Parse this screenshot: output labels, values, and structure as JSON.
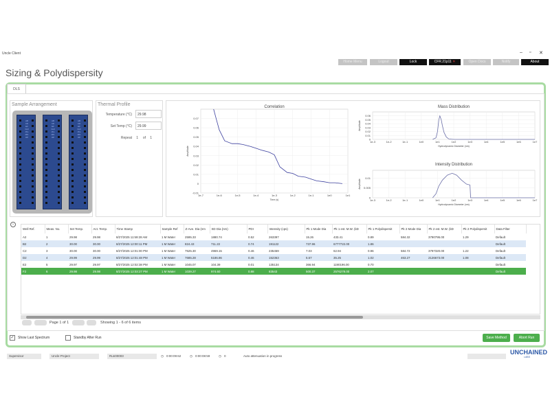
{
  "window": {
    "app_title": "Uncle Client",
    "minimize": "–",
    "maximize": "▫",
    "close": "✕"
  },
  "nav": {
    "home_menu": "Home Menu",
    "logout": "Logout",
    "lock": "Lock",
    "instrument": "CFR.21p11",
    "instrument_mark": "✕",
    "open_docs": "Open Docs",
    "notify": "Notify",
    "about": "About"
  },
  "page_title": "Sizing & Polydispersity",
  "tabs": [
    {
      "label": "DLS"
    }
  ],
  "sample_arrangement": {
    "title": "Sample Arrangement",
    "strip_letters": "ABCDEFGHIJKLMNOP"
  },
  "thermal_profile": {
    "title": "Thermal Profile",
    "temperature_label": "Temperature (°C)",
    "temperature_value": "29.98",
    "set_temp_label": "Set Temp (°C)",
    "set_temp_value": "29.99",
    "repeat_label": "Repeat",
    "repeat_current": "1",
    "repeat_of": "of",
    "repeat_total": "1"
  },
  "chart_data": [
    {
      "type": "line",
      "title": "Correlation",
      "xlabel": "Time (s)",
      "ylabel": "Amplitude",
      "x_scale": "log",
      "xlim": [
        1e-07,
        10
      ],
      "ylim": [
        -0.01,
        0.08
      ],
      "x_ticks": [
        "1e-7",
        "1e-6",
        "1e-5",
        "1e-4",
        "1e-3",
        "1e-2",
        "1e-1",
        "1e0",
        "1e1"
      ],
      "y_ticks": [
        "-0.01",
        "0",
        "0.01",
        "0.02",
        "0.03",
        "0.04",
        "0.05",
        "0.06",
        "0.07"
      ],
      "color": "#3b3f9e",
      "x": [
        5e-07,
        1e-06,
        2e-06,
        5e-06,
        1e-05,
        2e-05,
        5e-05,
        0.0001,
        0.0002,
        0.0005,
        0.001,
        0.002,
        0.005,
        0.01,
        0.02,
        0.05,
        0.1,
        0.2,
        0.5,
        1,
        2,
        5
      ],
      "y": [
        0.08,
        0.058,
        0.046,
        0.043,
        0.043,
        0.042,
        0.04,
        0.038,
        0.036,
        0.034,
        0.031,
        0.018,
        0.012,
        0.011,
        0.008,
        0.007,
        0.005,
        0.003,
        0.002,
        0.001,
        0.001,
        0.0
      ]
    },
    {
      "type": "line",
      "title": "Mass Distribution",
      "xlabel": "Hydrodynamic Diameter (nm)",
      "ylabel": "Amplitude",
      "x_scale": "log",
      "xlim": [
        0.001,
        10000000.0
      ],
      "ylim": [
        0,
        0.07
      ],
      "x_ticks": [
        "1e-3",
        "1e-2",
        "1e-1",
        "1e0",
        "1e1",
        "1e2",
        "1e3",
        "1e4",
        "1e5",
        "1e6",
        "1e7"
      ],
      "y_ticks": [
        "0",
        "0.01",
        "0.02",
        "0.03",
        "0.04",
        "0.05",
        "0.06"
      ],
      "color": "#6b6fa8",
      "x": [
        5,
        8,
        10,
        12,
        14,
        17,
        20,
        25,
        35,
        50,
        100,
        1000,
        10000000.0
      ],
      "y": [
        0,
        0.004,
        0.02,
        0.05,
        0.06,
        0.05,
        0.035,
        0.018,
        0.006,
        0.001,
        0,
        0,
        0
      ]
    },
    {
      "type": "line",
      "title": "Intensity Distribution",
      "xlabel": "Hydrodynamic Diameter (nm)",
      "ylabel": "Amplitude",
      "x_scale": "log",
      "xlim": [
        0.001,
        10000000.0
      ],
      "ylim": [
        0,
        0.014
      ],
      "x_ticks": [
        "1e-3",
        "1e-2",
        "1e-1",
        "1e0",
        "1e1",
        "1e2",
        "1e3",
        "1e4",
        "1e5",
        "1e6",
        "1e7"
      ],
      "y_ticks": [
        "0",
        "0.005",
        "0.01"
      ],
      "color": "#6b6fa8",
      "x": [
        5,
        8,
        12,
        20,
        40,
        80,
        150,
        300,
        600,
        1000,
        1100,
        10000000.0
      ],
      "y": [
        0,
        0.002,
        0.006,
        0.009,
        0.0115,
        0.0125,
        0.0115,
        0.009,
        0.007,
        0.0065,
        0,
        0
      ]
    }
  ],
  "table": {
    "columns": [
      "Well Ref.",
      "Meas. No.",
      "Set Temp.",
      "Act. Temp.",
      "Time Stamp",
      "Sample Ref",
      "Z-Ave. Dia (nm",
      "SD Dia (nm)",
      "PDI",
      "Intensity (cps)",
      "Pk 1 Mode Dia",
      "Pk 1 est. M.W. (kD",
      "Pk 1 Polydispersit",
      "Pk 2 Mode Dia",
      "Pk 2 est. M.W. (kD",
      "Pk 2 Polydispersit",
      "Data Filter"
    ],
    "rows": [
      [
        "A2",
        "1",
        "29.98",
        "29.98",
        "8/27/2025 11:59:28 AM",
        "1 M Water",
        "2595.33",
        "1880.74",
        "0.52",
        "263397",
        "15.26",
        "433.41",
        "0.89",
        "584.32",
        "3790795.00",
        "1.29",
        "Default"
      ],
      [
        "B2",
        "2",
        "30.00",
        "30.00",
        "8/27/2025 12:00:11 PM",
        "1 M Water",
        "824.43",
        "711.22",
        "0.74",
        "191122",
        "737.96",
        "6777722.00",
        "1.86",
        "",
        "",
        "",
        "Default"
      ],
      [
        "C2",
        "3",
        "30.00",
        "30.00",
        "8/27/2025 12:01:00 PM",
        "1 M Water",
        "7525.30",
        "4969.15",
        "0.46",
        "235459",
        "7.03",
        "62.94",
        "0.96",
        "584.72",
        "3797320.00",
        "1.22",
        "Default"
      ],
      [
        "D2",
        "4",
        "29.99",
        "29.99",
        "8/27/2025 12:01:48 PM",
        "1 M Water",
        "7685.28",
        "5186.86",
        "0.46",
        "152363",
        "5.57",
        "35.25",
        "1.02",
        "463.27",
        "2126673.00",
        "1.08",
        "Default"
      ],
      [
        "E2",
        "5",
        "29.97",
        "29.97",
        "8/27/2025 12:02:38 PM",
        "1 M Water",
        "1045.07",
        "104.39",
        "0.01",
        "135134",
        "366.94",
        "1190196.00",
        "0.70",
        "",
        "",
        "",
        "Default"
      ],
      [
        "F2",
        "6",
        "29.98",
        "29.98",
        "8/27/2025 12:03:27 PM",
        "1 M Water",
        "1039.27",
        "974.60",
        "0.88",
        "83543",
        "500.37",
        "2576278.00",
        "2.07",
        "",
        "",
        "",
        "Default"
      ]
    ],
    "selected_row": 5
  },
  "pager": {
    "page_label": "Page 1 of 1",
    "showing": "Showing 1 - 6 of 6 items"
  },
  "options": {
    "show_last_spectrum": "Show Last Spectrum",
    "show_last_spectrum_checked": "✓",
    "standby_after_run": "Standby After Run"
  },
  "buttons": {
    "save_method": "Save Method",
    "abort_run": "Abort Run"
  },
  "status": {
    "user": "Supervisor",
    "project": "Uncle Project",
    "run": "Run00003",
    "time_elapsed": "0:00:09:62",
    "time_remaining": "0:00:08:59",
    "count": "0",
    "message": "Auto attenuation in progress"
  },
  "brand": {
    "logo": "UNCHAINED",
    "sub": "LABS"
  }
}
